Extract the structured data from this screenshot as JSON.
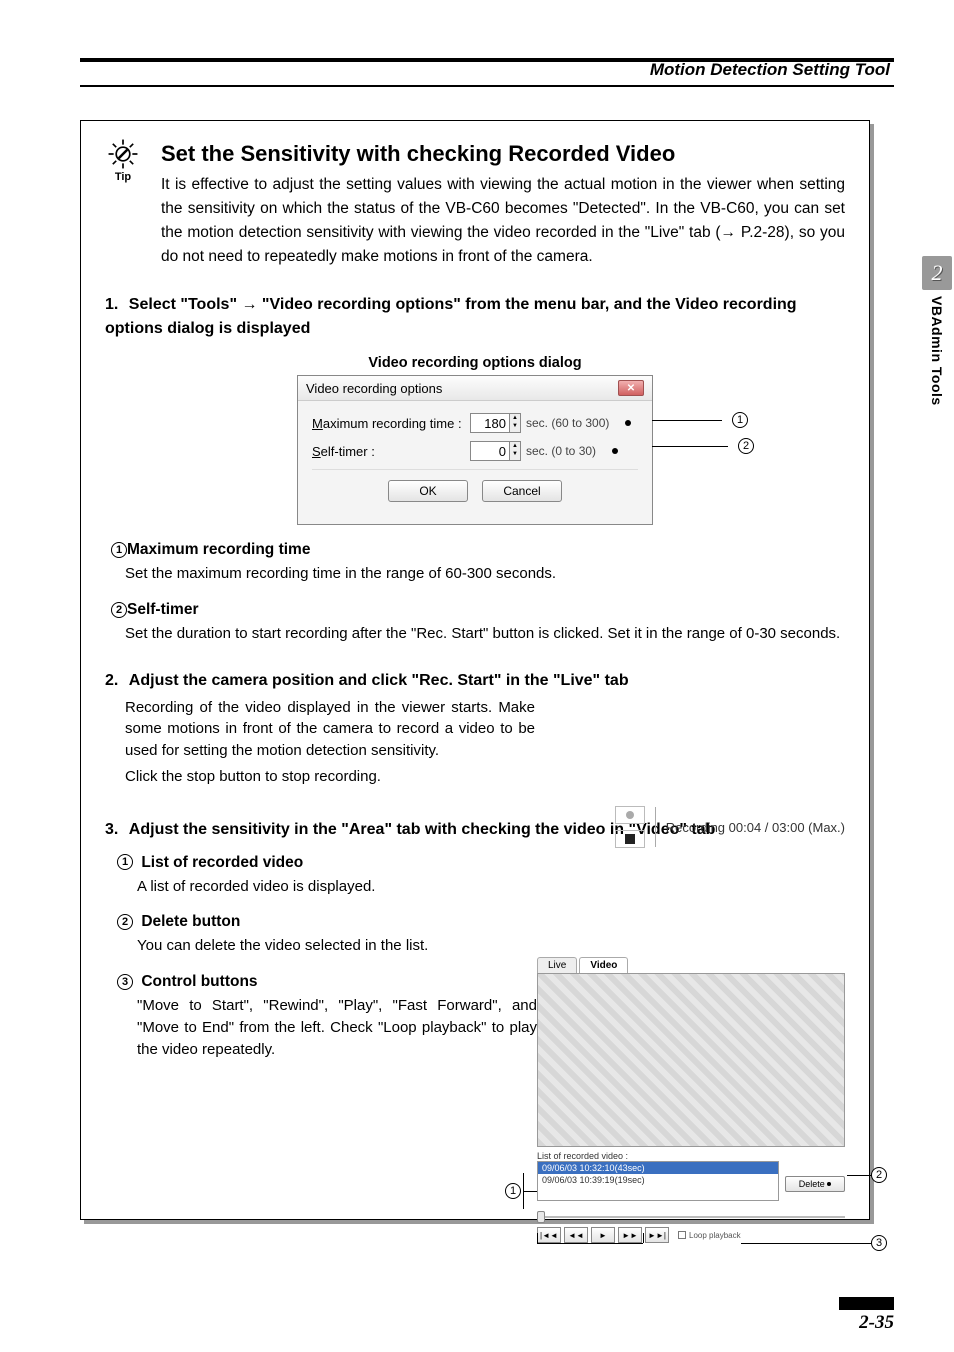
{
  "header": {
    "section_title": "Motion Detection Setting Tool"
  },
  "side_tab": {
    "chapter": "2",
    "label": "VBAdmin Tools"
  },
  "tip": {
    "label": "Tip",
    "title": "Set the Sensitivity with checking Recorded Video",
    "intro": "It is effective to adjust the setting values with viewing the actual motion in the viewer when setting the sensitivity on which the status of the VB-C60 becomes \"Detected\". In the VB-C60, you can set the motion detection sensitivity with viewing the video recorded in the \"Live\" tab (→ P.2-28), so you do not need to repeatedly make motions in front of the camera."
  },
  "step1": {
    "heading_prefix": "1.",
    "heading": "Select \"Tools\" → \"Video recording options\" from the menu bar, and the Video recording options dialog is displayed",
    "dialog_caption": "Video recording options dialog",
    "dialog": {
      "title": "Video recording options",
      "row1_label": "Maximum recording time :",
      "row1_value": "180",
      "row1_range": "sec. (60 to 300)",
      "row2_label": "Self-timer :",
      "row2_value": "0",
      "row2_range": "sec. (0 to 30)",
      "ok": "OK",
      "cancel": "Cancel"
    },
    "callout1_num": "1",
    "callout2_num": "2",
    "item1_h": "Maximum recording time",
    "item1_p": "Set the maximum recording time in the range of 60-300 seconds.",
    "item2_h": "Self-timer",
    "item2_p": "Set the duration to start recording after the \"Rec. Start\" button is clicked. Set it in the range of 0-30 seconds."
  },
  "step2": {
    "heading_prefix": "2.",
    "heading": "Adjust the camera position and click \"Rec. Start\" in the \"Live\" tab",
    "p1": "Recording of the video displayed in the viewer starts. Make some motions in front of the camera to record a video to be used for setting the motion detection sensitivity.",
    "p2": "Click the stop button to stop recording.",
    "recording_status": "Recording  00:04 / 03:00 (Max.)"
  },
  "step3": {
    "heading_prefix": "3.",
    "heading": "Adjust the sensitivity in the \"Area\" tab with checking the video in \"Video\" tab",
    "item1_num": "1",
    "item1_h": "List of recorded video",
    "item1_p": "A list of recorded video is displayed.",
    "item2_num": "2",
    "item2_h": "Delete button",
    "item2_p": "You can delete the video selected in the list.",
    "item3_num": "3",
    "item3_h": "Control buttons",
    "item3_p": "\"Move to Start\", \"Rewind\", \"Play\", \"Fast Forward\", and \"Move to End\" from the left. Check \"Loop playback\" to play the video repeatedly.",
    "fig": {
      "tabs": {
        "live": "Live",
        "video": "Video"
      },
      "list_label": "List of recorded video :",
      "list_row1": "09/06/03 10:32:10(43sec)",
      "list_row2": "09/06/03 10:39:19(19sec)",
      "delete": "Delete",
      "controls": [
        "|◄◄",
        "◄◄",
        "►",
        "►►",
        "►►|"
      ],
      "loop": "Loop playback"
    }
  },
  "page_number": "2-35"
}
